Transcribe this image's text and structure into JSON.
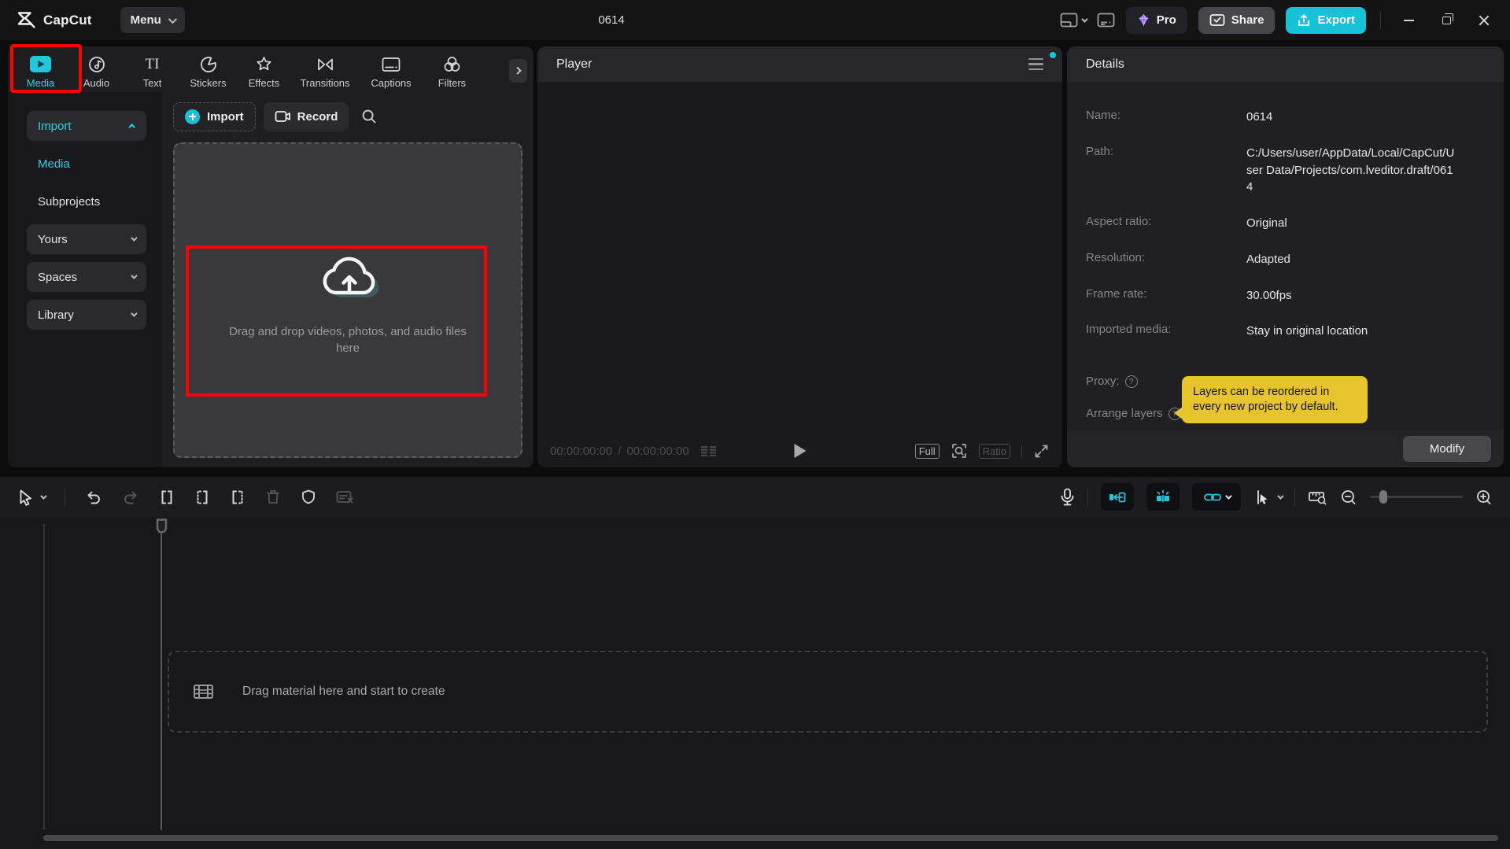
{
  "colors": {
    "accent_cyan": "#16c2d6",
    "highlight_red": "#fe0202",
    "tooltip_yellow": "#e8c42c"
  },
  "topbar": {
    "logo_text": "CapCut",
    "menu_label": "Menu",
    "project_title": "0614",
    "pro_label": "Pro",
    "share_label": "Share",
    "export_label": "Export"
  },
  "tabs": [
    {
      "label": "Media"
    },
    {
      "label": "Audio"
    },
    {
      "label": "Text"
    },
    {
      "label": "Stickers"
    },
    {
      "label": "Effects"
    },
    {
      "label": "Transitions"
    },
    {
      "label": "Captions"
    },
    {
      "label": "Filters"
    }
  ],
  "sidebar": {
    "items": [
      {
        "label": "Import"
      },
      {
        "label": "Media"
      },
      {
        "label": "Subprojects"
      },
      {
        "label": "Yours"
      },
      {
        "label": "Spaces"
      },
      {
        "label": "Library"
      }
    ]
  },
  "media": {
    "import_label": "Import",
    "record_label": "Record",
    "dropzone_text": "Drag and drop videos, photos, and audio files here"
  },
  "player": {
    "title": "Player",
    "time_current": "00:00:00:00",
    "time_separator": "/",
    "time_total": "00:00:00:00",
    "full_label": "Full",
    "ratio_label": "Ratio"
  },
  "details": {
    "title": "Details",
    "rows": [
      {
        "label": "Name:",
        "value": "0614"
      },
      {
        "label": "Path:",
        "value": "C:/Users/user/AppData/Local/CapCut/User Data/Projects/com.lveditor.draft/0614"
      },
      {
        "label": "Aspect ratio:",
        "value": "Original"
      },
      {
        "label": "Resolution:",
        "value": "Adapted"
      },
      {
        "label": "Frame rate:",
        "value": "30.00fps"
      },
      {
        "label": "Imported media:",
        "value": "Stay in original location"
      }
    ],
    "proxy_label": "Proxy:",
    "arrange_label": "Arrange layers",
    "tooltip_text": "Layers can be reordered in every new project by default.",
    "modify_label": "Modify"
  },
  "timeline": {
    "drop_text": "Drag material here and start to create"
  }
}
